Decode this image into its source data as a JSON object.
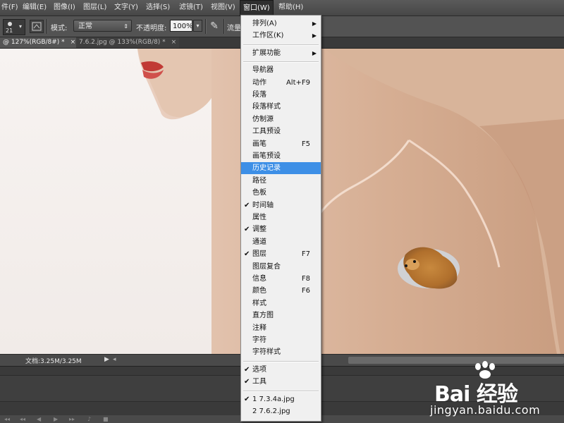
{
  "menubar": {
    "items": [
      {
        "label": "件(F)"
      },
      {
        "label": "编辑(E)"
      },
      {
        "label": "图像(I)"
      },
      {
        "label": "图层(L)"
      },
      {
        "label": "文字(Y)"
      },
      {
        "label": "选择(S)"
      },
      {
        "label": "滤镜(T)"
      },
      {
        "label": "视图(V)"
      },
      {
        "label": "窗口(W)"
      },
      {
        "label": "帮助(H)"
      }
    ]
  },
  "options": {
    "brush_size": "21",
    "mode_label": "模式:",
    "mode_value": "正常",
    "opacity_label": "不透明度:",
    "opacity_value": "100%",
    "flow_label": "流量"
  },
  "tabs": [
    {
      "label": "@ 127%(RGB/8#) *",
      "close": "×"
    },
    {
      "label": "7.6.2.jpg @ 133%(RGB/8) *",
      "close": "×"
    }
  ],
  "status": {
    "doc_info": "文档:3.25M/3.25M"
  },
  "window_menu": {
    "groups": [
      [
        {
          "label": "排列(A)",
          "shortcut": "",
          "submenu": true,
          "checked": false
        },
        {
          "label": "工作区(K)",
          "shortcut": "",
          "submenu": true,
          "checked": false
        }
      ],
      [
        {
          "label": "扩展功能",
          "shortcut": "",
          "submenu": true,
          "checked": false
        }
      ],
      [
        {
          "label": "导航器",
          "shortcut": "",
          "submenu": false,
          "checked": false
        },
        {
          "label": "动作",
          "shortcut": "Alt+F9",
          "submenu": false,
          "checked": false
        },
        {
          "label": "段落",
          "shortcut": "",
          "submenu": false,
          "checked": false
        },
        {
          "label": "段落样式",
          "shortcut": "",
          "submenu": false,
          "checked": false
        },
        {
          "label": "仿制源",
          "shortcut": "",
          "submenu": false,
          "checked": false
        },
        {
          "label": "工具预设",
          "shortcut": "",
          "submenu": false,
          "checked": false
        },
        {
          "label": "画笔",
          "shortcut": "F5",
          "submenu": false,
          "checked": false
        },
        {
          "label": "画笔预设",
          "shortcut": "",
          "submenu": false,
          "checked": false
        },
        {
          "label": "历史记录",
          "shortcut": "",
          "submenu": false,
          "checked": false,
          "highlighted": true
        },
        {
          "label": "路径",
          "shortcut": "",
          "submenu": false,
          "checked": false
        },
        {
          "label": "色板",
          "shortcut": "",
          "submenu": false,
          "checked": false
        },
        {
          "label": "时间轴",
          "shortcut": "",
          "submenu": false,
          "checked": true
        },
        {
          "label": "属性",
          "shortcut": "",
          "submenu": false,
          "checked": false
        },
        {
          "label": "调整",
          "shortcut": "",
          "submenu": false,
          "checked": true
        },
        {
          "label": "通道",
          "shortcut": "",
          "submenu": false,
          "checked": false
        },
        {
          "label": "图层",
          "shortcut": "F7",
          "submenu": false,
          "checked": true
        },
        {
          "label": "图层复合",
          "shortcut": "",
          "submenu": false,
          "checked": false
        },
        {
          "label": "信息",
          "shortcut": "F8",
          "submenu": false,
          "checked": false
        },
        {
          "label": "颜色",
          "shortcut": "F6",
          "submenu": false,
          "checked": false
        },
        {
          "label": "样式",
          "shortcut": "",
          "submenu": false,
          "checked": false
        },
        {
          "label": "直方图",
          "shortcut": "",
          "submenu": false,
          "checked": false
        },
        {
          "label": "注释",
          "shortcut": "",
          "submenu": false,
          "checked": false
        },
        {
          "label": "字符",
          "shortcut": "",
          "submenu": false,
          "checked": false
        },
        {
          "label": "字符样式",
          "shortcut": "",
          "submenu": false,
          "checked": false
        }
      ],
      [
        {
          "label": "选项",
          "shortcut": "",
          "submenu": false,
          "checked": true
        },
        {
          "label": "工具",
          "shortcut": "",
          "submenu": false,
          "checked": true
        }
      ],
      [
        {
          "label": "1 7.3.4a.jpg",
          "shortcut": "",
          "submenu": false,
          "checked": true
        },
        {
          "label": "2 7.6.2.jpg",
          "shortcut": "",
          "submenu": false,
          "checked": false
        }
      ]
    ]
  },
  "watermark": {
    "brand": "Bai 经验",
    "url": "jingyan.baidu.com"
  },
  "colors": {
    "highlight": "#3d8fe6",
    "menu_bg": "#f0f0f0",
    "ui_dark": "#3c3c3c"
  }
}
